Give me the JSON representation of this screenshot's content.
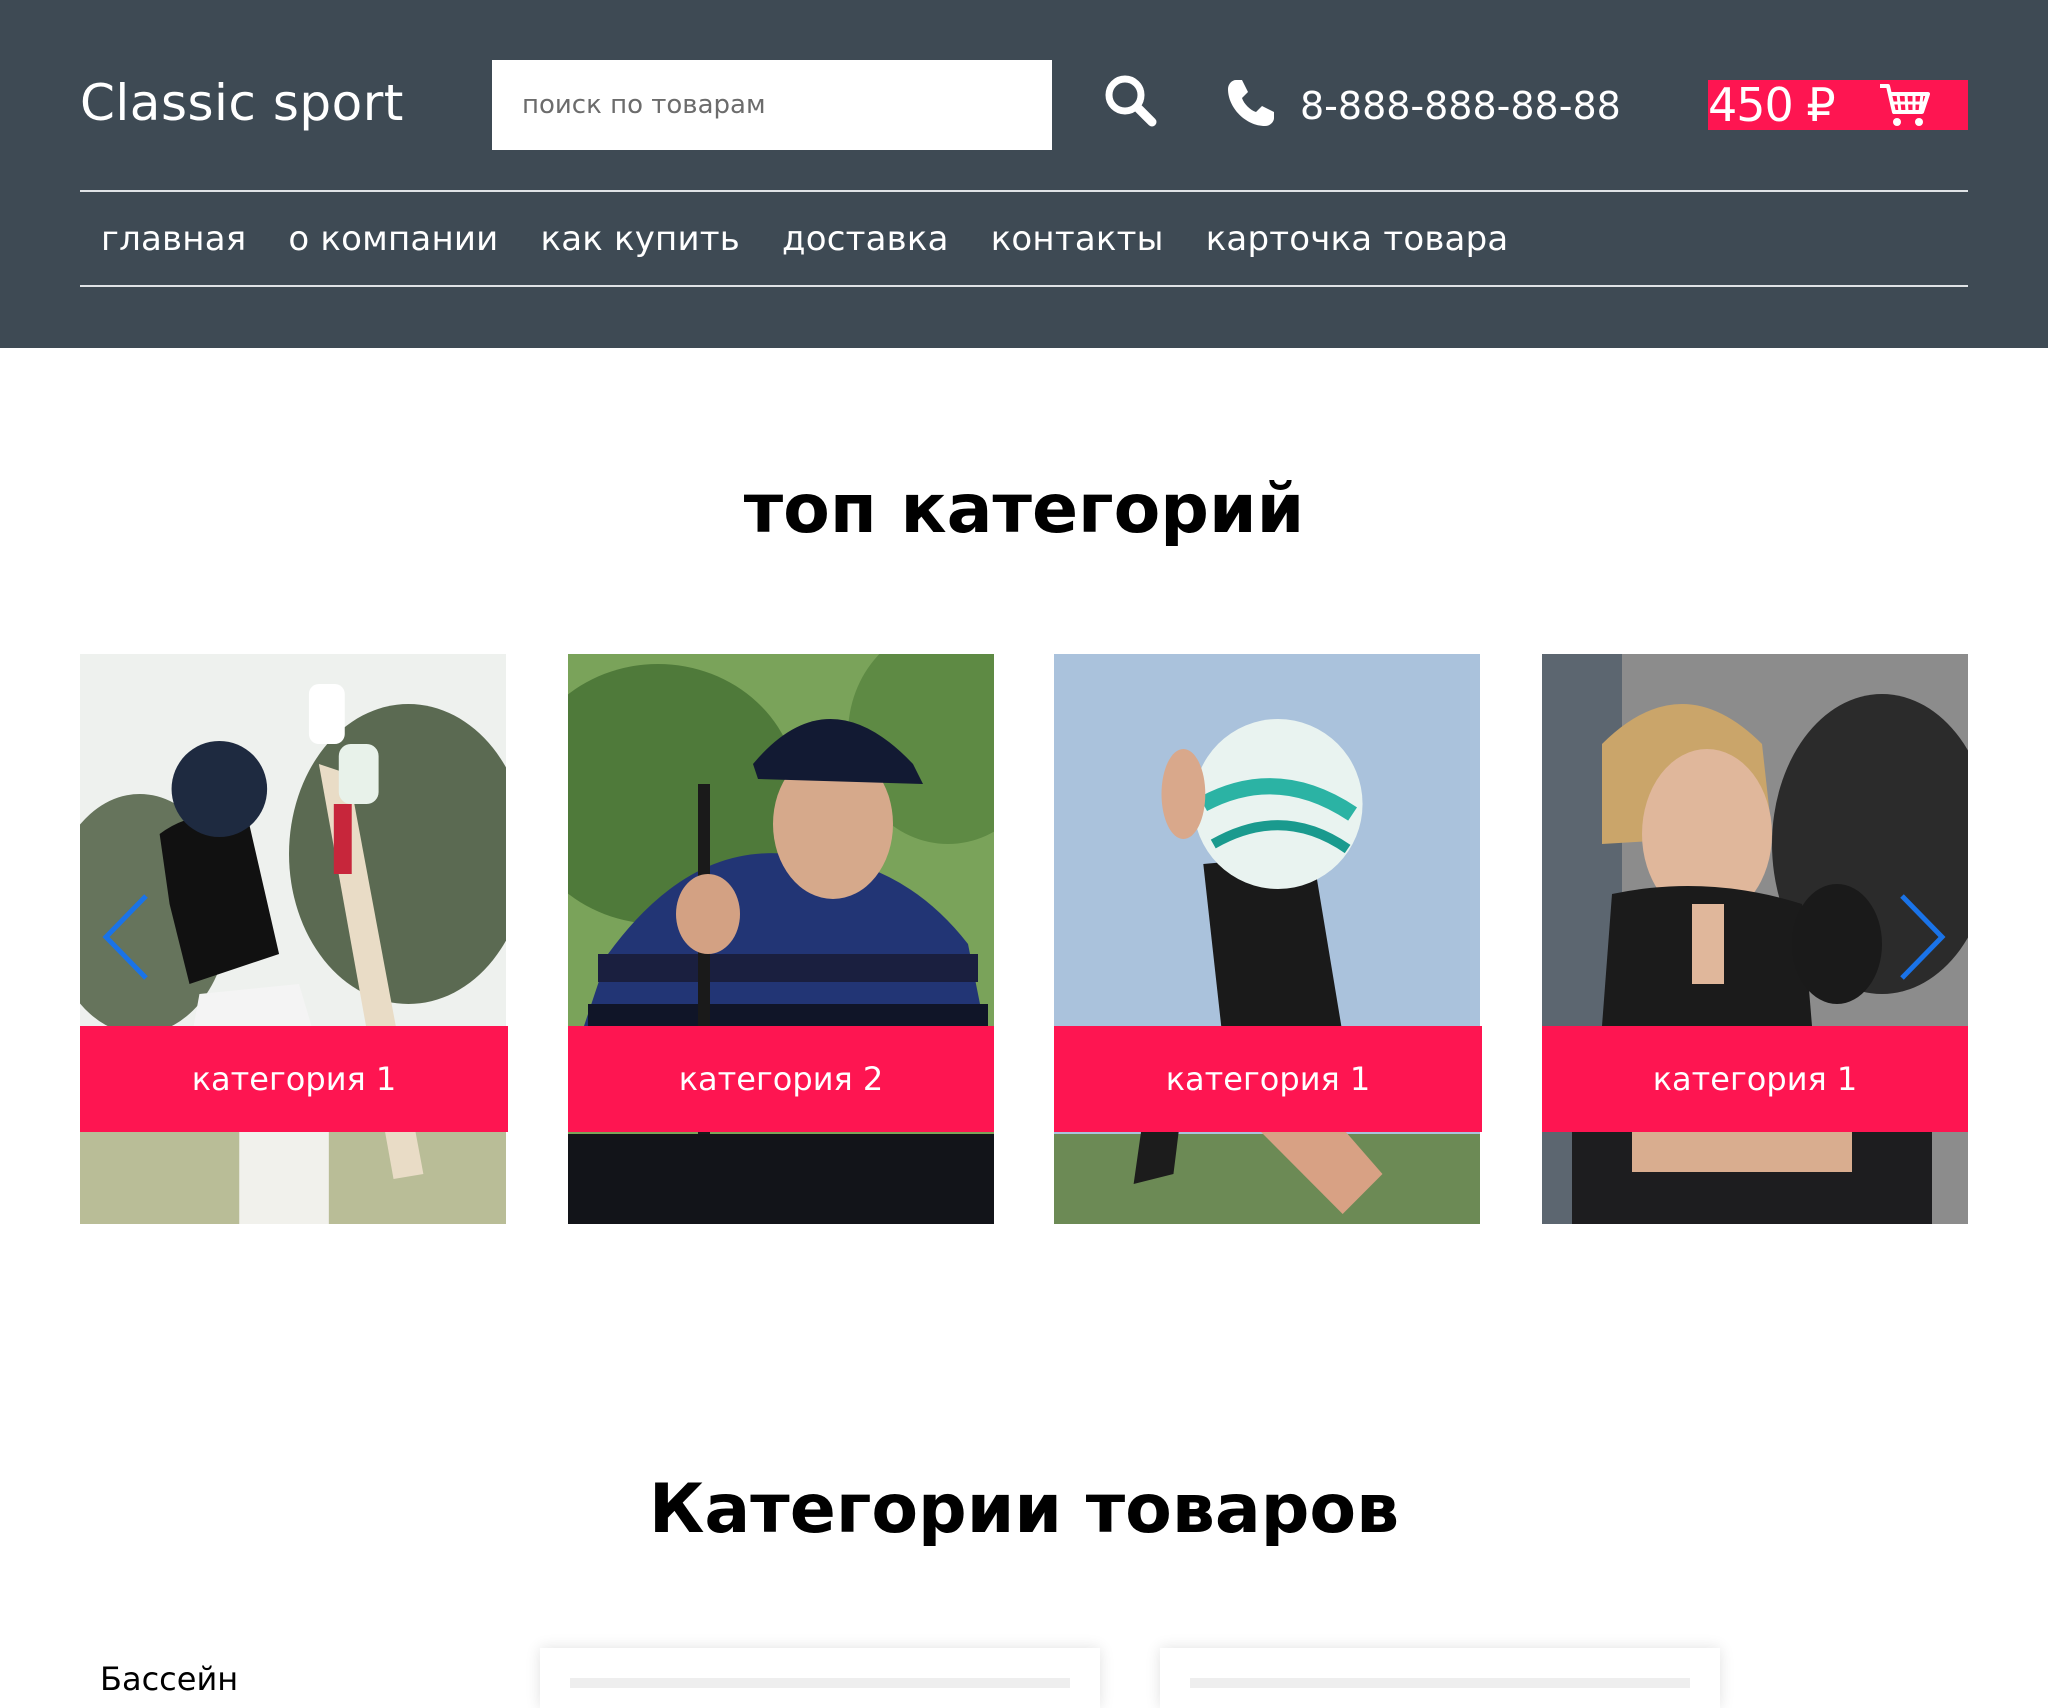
{
  "header": {
    "logo": "Classic sport",
    "search_placeholder": "поиск по товарам",
    "phone": "8-888-888-88-88",
    "cart_total": "450 ₽"
  },
  "nav": {
    "items": [
      {
        "label": "главная"
      },
      {
        "label": "о компании"
      },
      {
        "label": "как купить"
      },
      {
        "label": "доставка"
      },
      {
        "label": "контакты"
      },
      {
        "label": "карточка товара"
      }
    ]
  },
  "top_categories": {
    "title": "топ категорий",
    "cards": [
      {
        "label": "категория 1"
      },
      {
        "label": "категория 2"
      },
      {
        "label": "категория 1"
      },
      {
        "label": "категория 1"
      }
    ]
  },
  "product_categories": {
    "title": "Категории товаров",
    "first_sidebar_item": "Бассейн"
  },
  "colors": {
    "header_bg": "#3e4a54",
    "accent": "#fe1551",
    "arrow": "#1a73e8"
  }
}
